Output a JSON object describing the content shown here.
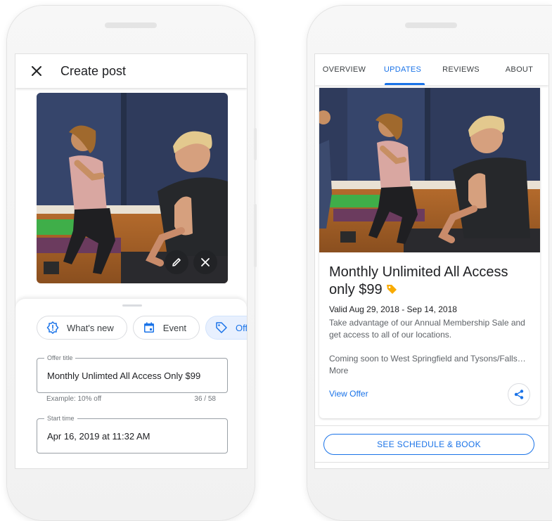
{
  "colors": {
    "accent": "#1a73e8",
    "chip_selected_bg": "#e8f0fe",
    "tag": "#f9ab00"
  },
  "create_post": {
    "title": "Create post",
    "icons": {
      "close": "close-icon",
      "edit": "pencil-icon",
      "remove": "close-icon"
    },
    "chips": [
      {
        "label": "What's new",
        "icon": "alert-circle-icon",
        "selected": false
      },
      {
        "label": "Event",
        "icon": "calendar-icon",
        "selected": false
      },
      {
        "label": "Offer",
        "icon": "tag-icon",
        "selected": true
      }
    ],
    "offer_title": {
      "label": "Offer title",
      "value": "Monthly Unlimted All Access Only $99",
      "helper": "Example: 10% off",
      "counter": "36 / 58"
    },
    "start_time": {
      "label": "Start time",
      "value": "Apr 16, 2019 at 11:32 AM"
    }
  },
  "business_profile": {
    "tabs": [
      {
        "label": "OVERVIEW",
        "active": false
      },
      {
        "label": "UPDATES",
        "active": true
      },
      {
        "label": "REVIEWS",
        "active": false
      },
      {
        "label": "ABOUT",
        "active": false
      }
    ],
    "post": {
      "title": "Monthly Unlimited All Access only $99",
      "valid": "Valid Aug 29, 2018 - Sep 14, 2018",
      "description": "Take advantage of our Annual Membership Sale and get access to all of our locations.",
      "description_more": "Coming soon to West Springfield and Tysons/Falls… More",
      "view_offer": "View Offer",
      "share_icon": "share-icon"
    },
    "book_button": "SEE SCHEDULE & BOOK"
  }
}
